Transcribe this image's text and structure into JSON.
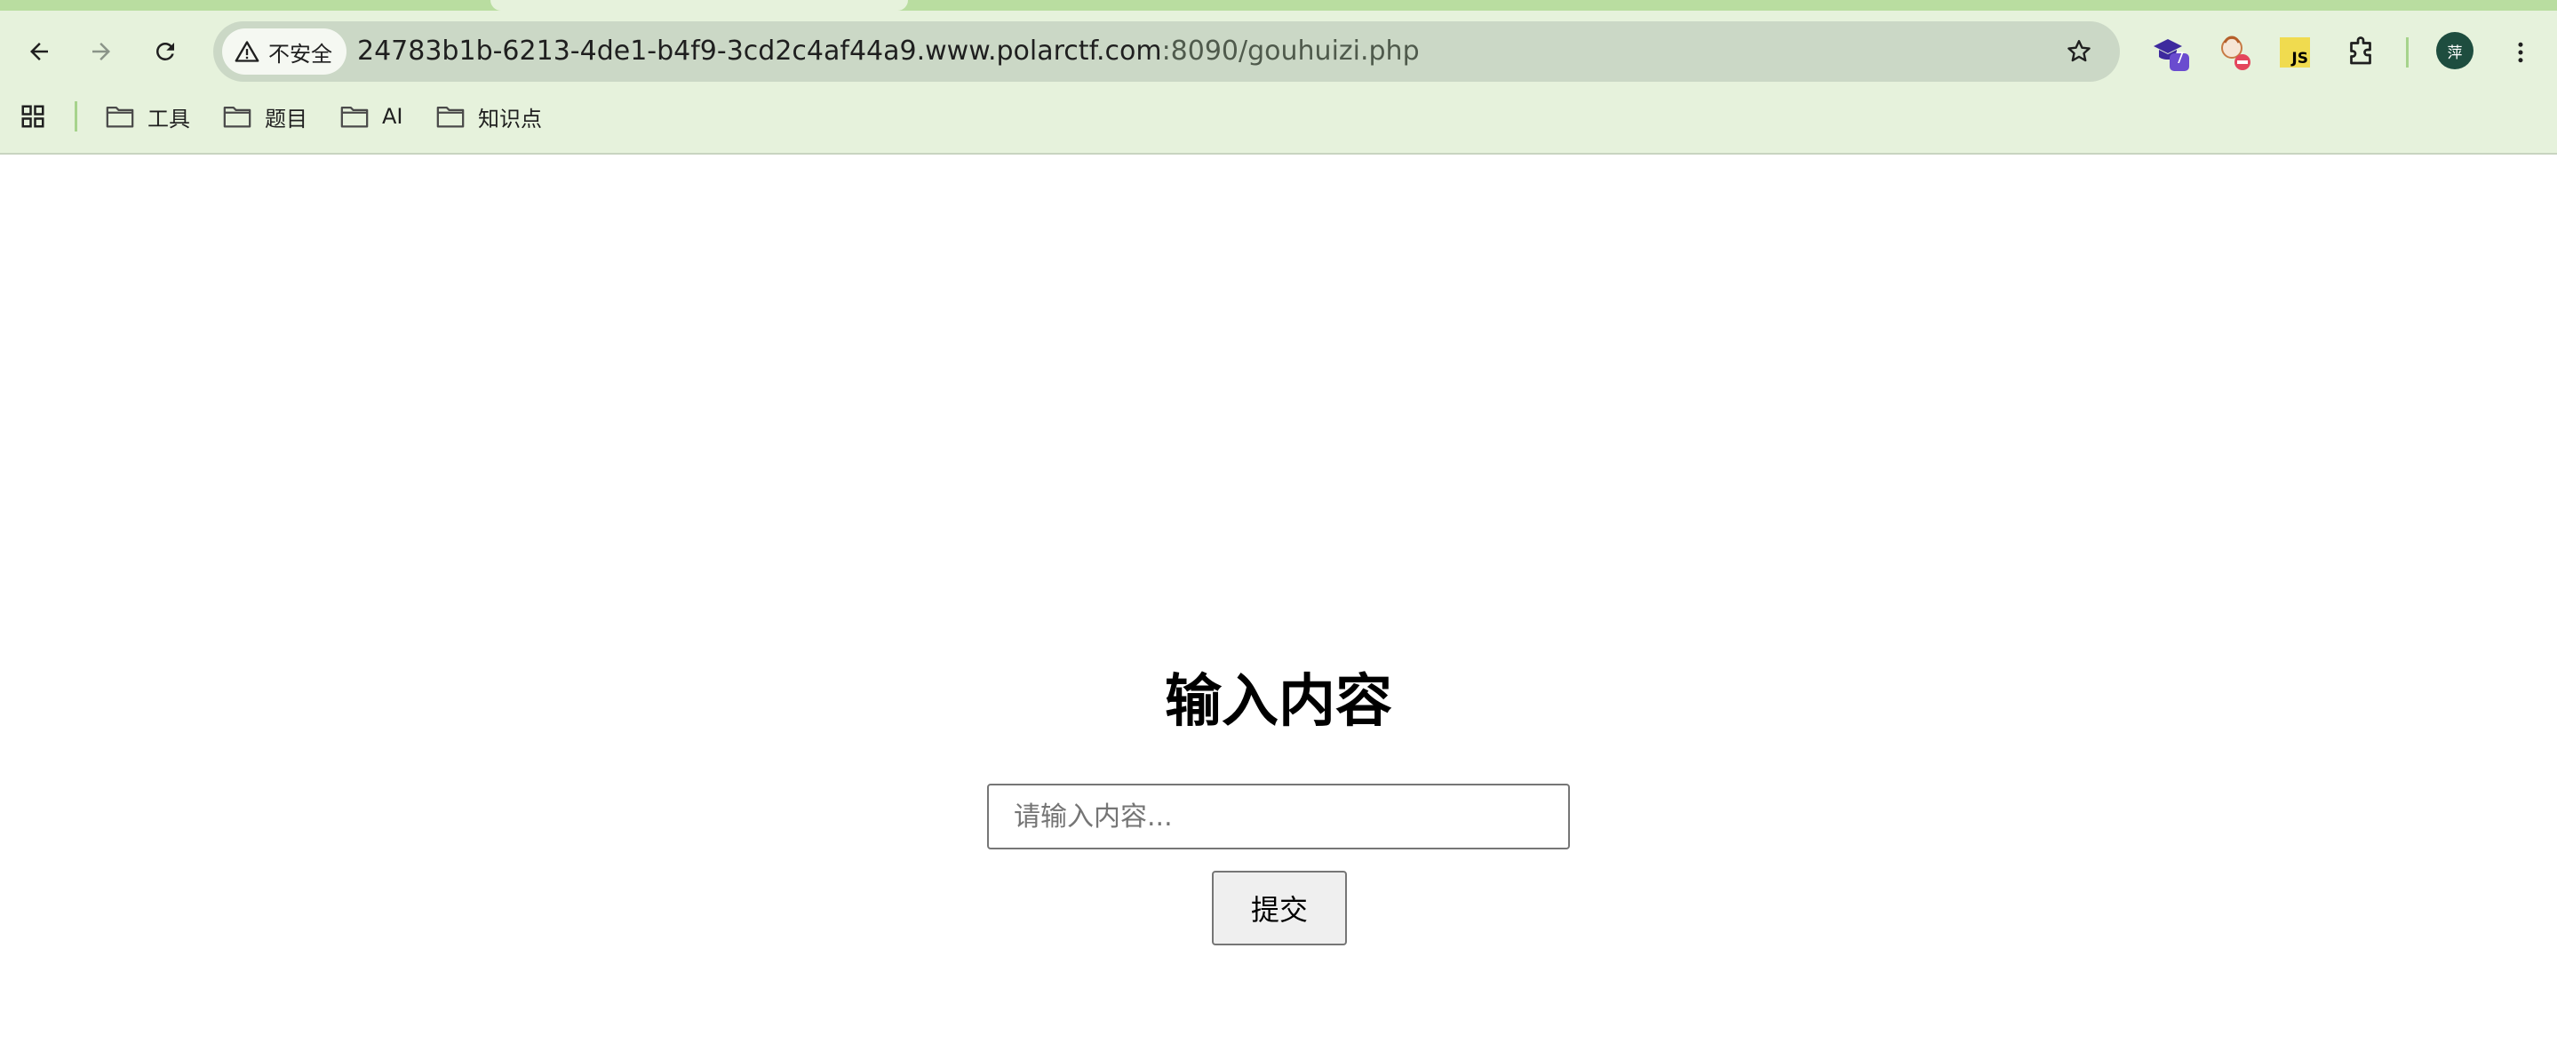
{
  "browser": {
    "security_label": "不安全",
    "url_host": "24783b1b-6213-4de1-b4f9-3cd2c4af44a9.www.polarctf.com",
    "url_path": ":8090/gouhuizi.php",
    "bookmarks": [
      {
        "label": "工具",
        "icon": "folder-icon"
      },
      {
        "label": "题目",
        "icon": "folder-icon"
      },
      {
        "label": "AI",
        "icon": "folder-icon"
      },
      {
        "label": "知识点",
        "icon": "folder-icon"
      }
    ],
    "extensions": {
      "badge_count": "7",
      "js_label": "JS"
    },
    "avatar_text": "萍",
    "colors": {
      "toolbar_bg": "#e6f2dc",
      "omnibox_bg": "#cbd8c6",
      "tabstrip_bg": "#b9dda0"
    }
  },
  "page": {
    "title": "输入内容",
    "input_placeholder": "请输入内容...",
    "input_value": "",
    "submit_label": "提交"
  }
}
